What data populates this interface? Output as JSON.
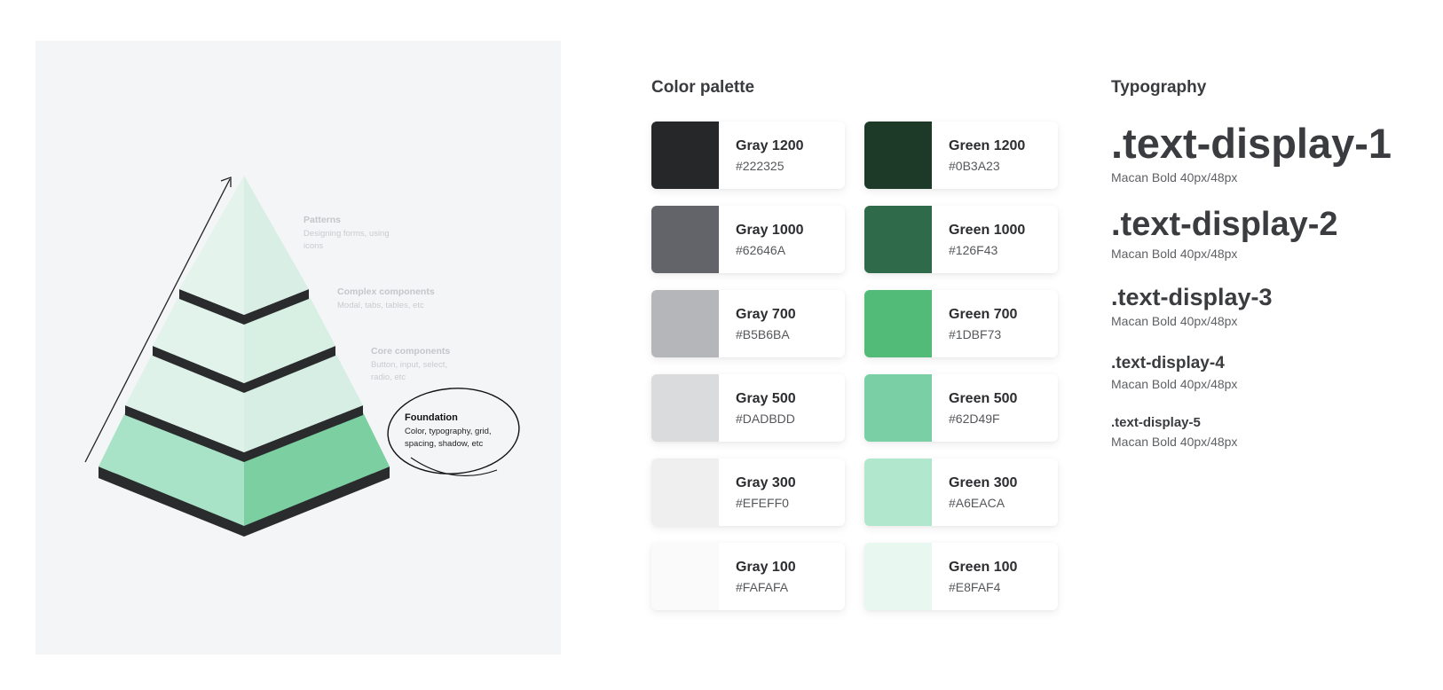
{
  "diagram": {
    "layers": [
      {
        "title": "Patterns",
        "description": "Designing forms, using icons"
      },
      {
        "title": "Complex components",
        "description": "Modal, tabs, tables, etc"
      },
      {
        "title": "Core components",
        "description": "Button, input, select, radio, etc"
      },
      {
        "title": "Foundation",
        "description": "Color, typography, grid, spacing, shadow, etc"
      }
    ]
  },
  "palette": {
    "title": "Color palette",
    "gray": [
      {
        "name": "Gray 1200",
        "hex": "#222325",
        "color": "#262729"
      },
      {
        "name": "Gray 1000",
        "hex": "#62646A",
        "color": "#62646a"
      },
      {
        "name": "Gray 700",
        "hex": "#B5B6BA",
        "color": "#b5b6ba"
      },
      {
        "name": "Gray 500",
        "hex": "#DADBDD",
        "color": "#dadbdd"
      },
      {
        "name": "Gray 300",
        "hex": "#EFEFF0",
        "color": "#efeff0"
      },
      {
        "name": "Gray 100",
        "hex": "#FAFAFA",
        "color": "#fafafa"
      }
    ],
    "green": [
      {
        "name": "Green 1200",
        "hex": "#0B3A23",
        "color": "#1c3a27"
      },
      {
        "name": "Green 1000",
        "hex": "#126F43",
        "color": "#2f6b4a"
      },
      {
        "name": "Green 700",
        "hex": "#1DBF73",
        "color": "#52bb78"
      },
      {
        "name": "Green 500",
        "hex": "#62D49F",
        "color": "#7bcfa4"
      },
      {
        "name": "Green 300",
        "hex": "#A6EACA",
        "color": "#b0e7cd"
      },
      {
        "name": "Green 100",
        "hex": "#E8FAF4",
        "color": "#e8f8f1"
      }
    ]
  },
  "typography": {
    "title": "Typography",
    "styles": [
      {
        "sample": ".text-display-1",
        "spec": "Macan Bold 40px/48px"
      },
      {
        "sample": ".text-display-2",
        "spec": "Macan Bold 40px/48px"
      },
      {
        "sample": ".text-display-3",
        "spec": "Macan Bold 40px/48px"
      },
      {
        "sample": ".text-display-4",
        "spec": "Macan Bold 40px/48px"
      },
      {
        "sample": ".text-display-5",
        "spec": "Macan Bold 40px/48px"
      }
    ]
  }
}
